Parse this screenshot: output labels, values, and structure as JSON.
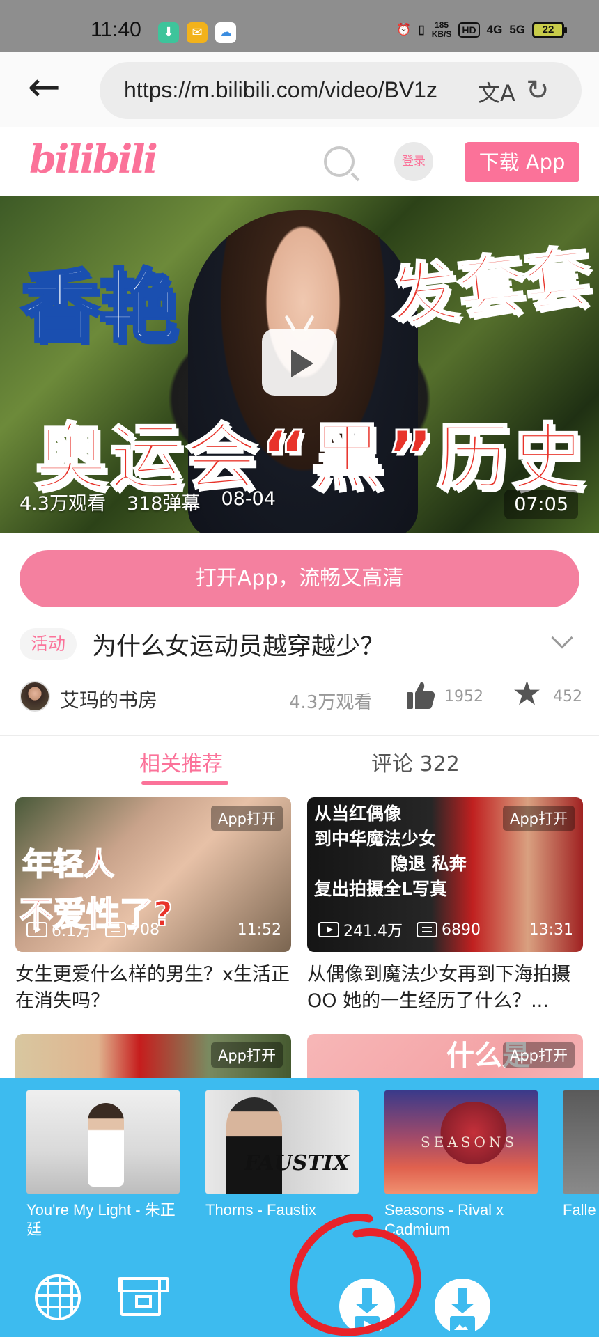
{
  "status_bar": {
    "time": "11:40",
    "net_speed_value": "185",
    "net_speed_unit": "KB/S",
    "hd_label": "HD",
    "signal_1": "4G",
    "signal_2": "5G",
    "battery": "22"
  },
  "browser": {
    "url": "https://m.bilibili.com/video/BV1z",
    "back_icon": "back-arrow-icon",
    "translate_icon": "translate-icon",
    "reload_icon": "reload-icon"
  },
  "site_header": {
    "logo": "bilibili",
    "login_label": "登录",
    "download_app_label": "下载 App",
    "brand_color": "#fb7299"
  },
  "video": {
    "thumbnail_text_1": "香艳",
    "thumbnail_text_2": "发套套",
    "thumbnail_text_3": "奥运会“黑”历史",
    "views": "4.3万观看",
    "danmaku": "318弹幕",
    "date": "08-04",
    "duration": "07:05"
  },
  "open_app_label": "打开App，流畅又高清",
  "video_info": {
    "tag": "活动",
    "title": "为什么女运动员越穿越少？",
    "author": "艾玛的书房",
    "views": "4.3万观看",
    "likes": "1952",
    "favorites": "452"
  },
  "tabs": {
    "related": "相关推荐",
    "comments": "评论 322"
  },
  "cards": [
    {
      "app_tag": "App打开",
      "overlay_1": "年轻人",
      "overlay_2": "不爱性了?",
      "views": "6.1万",
      "danmaku": "708",
      "duration": "11:52",
      "title": "女生更爱什么样的男生？x生活正在消失吗？"
    },
    {
      "app_tag": "App打开",
      "overlay_line_1": "从当红偶像",
      "overlay_line_2": "到中华魔法少女",
      "overlay_line_3": "隐退 私奔",
      "overlay_line_4": "复出拍摄全L写真",
      "views": "241.4万",
      "danmaku": "6890",
      "duration": "13:31",
      "title": "从偶像到魔法少女再到下海拍摄OO 她的一生经历了什么？..."
    },
    {
      "app_tag": "App打开"
    },
    {
      "app_tag": "App打开",
      "overlay": "什么是"
    }
  ],
  "media_panel": {
    "background": "#3dbbef",
    "tracks": [
      {
        "title": "You're My Light - 朱正廷"
      },
      {
        "title": "Thorns - Faustix",
        "art_label": "FAUSTIX"
      },
      {
        "title": "Seasons - Rival x Cadmium",
        "art_label": "SEASONS"
      },
      {
        "title": "Falle"
      }
    ],
    "buttons": [
      "globe-icon",
      "archive-icon",
      "download-video-icon",
      "download-image-icon"
    ]
  }
}
